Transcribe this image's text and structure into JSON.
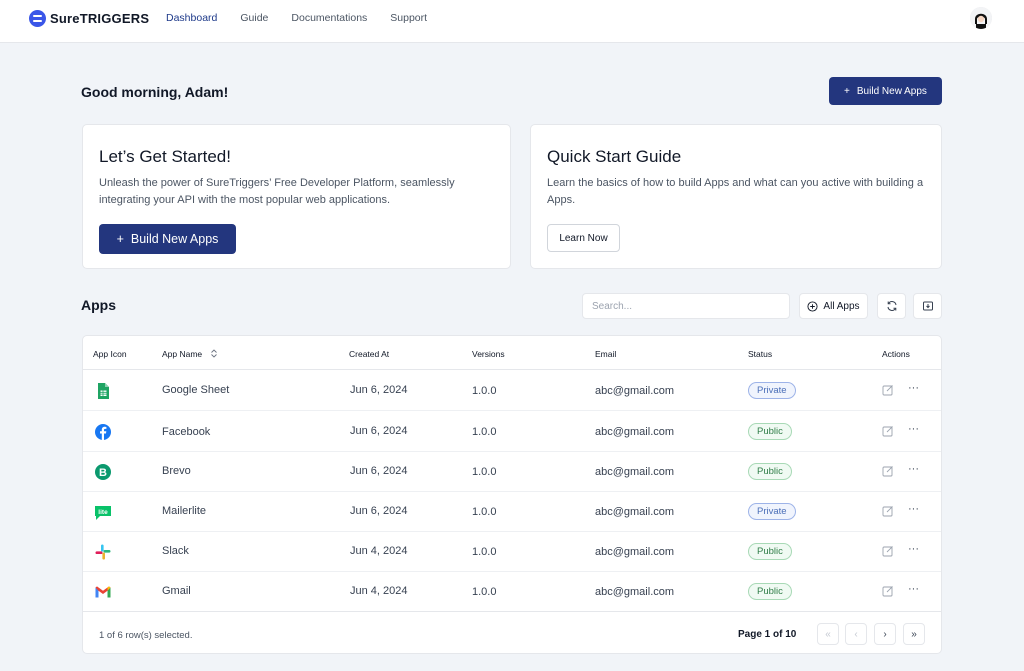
{
  "brand": {
    "name": "SureTRIGGERS",
    "accent": "#23367e",
    "logo_color": "#3a56e8"
  },
  "nav": {
    "items": [
      {
        "label": "Dashboard",
        "active": true
      },
      {
        "label": "Guide",
        "active": false
      },
      {
        "label": "Documentations",
        "active": false
      },
      {
        "label": "Support",
        "active": false
      }
    ]
  },
  "header": {
    "greeting": "Good morning, Adam!",
    "build_button": "Build New Apps",
    "build_button_icon": "plus-icon"
  },
  "cards": {
    "get_started": {
      "title": "Let’s Get Started!",
      "description": "Unleash the power of SureTriggers’ Free Developer Platform, seamlessly integrating your API with the most popular web applications.",
      "button": "Build New Apps"
    },
    "quick_start": {
      "title": "Quick Start Guide",
      "description": "Learn the basics of how to build Apps and what can you active with building a Apps.",
      "button": "Learn Now"
    }
  },
  "apps": {
    "title": "Apps",
    "search_placeholder": "Search...",
    "filter_label": "All Apps",
    "columns": [
      "App Icon",
      "App Name",
      "Created At",
      "Versions",
      "Email",
      "Status",
      "Actions"
    ],
    "rows": [
      {
        "icon": "google-sheets-icon",
        "name": "Google Sheet",
        "created": "Jun 6, 2024",
        "version": "1.0.0",
        "email": "abc@gmail.com",
        "status": "Private"
      },
      {
        "icon": "facebook-icon",
        "name": "Facebook",
        "created": "Jun 6, 2024",
        "version": "1.0.0",
        "email": "abc@gmail.com",
        "status": "Public"
      },
      {
        "icon": "brevo-icon",
        "name": "Brevo",
        "created": "Jun 6, 2024",
        "version": "1.0.0",
        "email": "abc@gmail.com",
        "status": "Public"
      },
      {
        "icon": "mailerlite-icon",
        "name": "Mailerlite",
        "created": "Jun 6, 2024",
        "version": "1.0.0",
        "email": "abc@gmail.com",
        "status": "Private"
      },
      {
        "icon": "slack-icon",
        "name": "Slack",
        "created": "Jun 4, 2024",
        "version": "1.0.0",
        "email": "abc@gmail.com",
        "status": "Public"
      },
      {
        "icon": "gmail-icon",
        "name": "Gmail",
        "created": "Jun 4, 2024",
        "version": "1.0.0",
        "email": "abc@gmail.com",
        "status": "Public"
      }
    ],
    "footer": {
      "selected": "1 of 6 row(s) selected.",
      "page": "Page 1 of 10",
      "first": "«",
      "prev": "‹",
      "next": "›",
      "last": "»"
    }
  }
}
